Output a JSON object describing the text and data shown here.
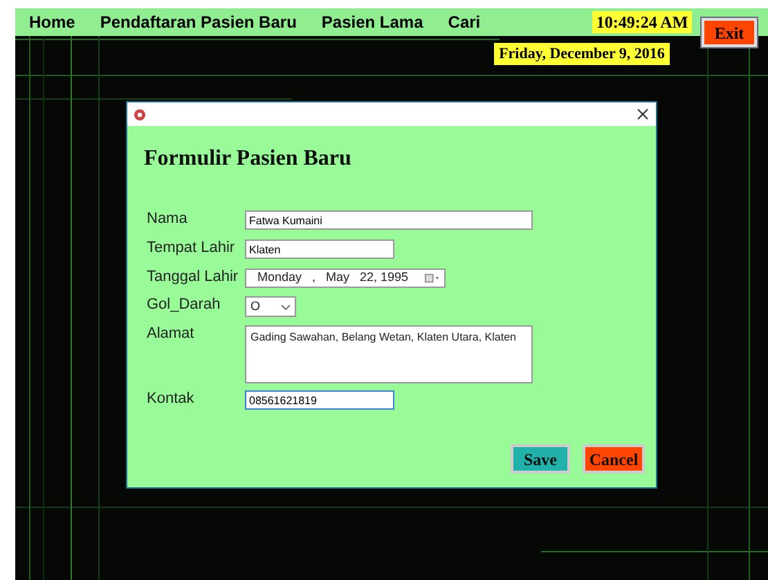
{
  "menu": [
    {
      "label": "Home"
    },
    {
      "label": "Pendaftaran Pasien Baru"
    },
    {
      "label": "Pasien Lama"
    },
    {
      "label": "Cari"
    }
  ],
  "clock": {
    "time": "10:49:24 AM",
    "date": "Friday, December 9, 2016"
  },
  "exit_button": "Exit",
  "dialog": {
    "title": "Formulir Pasien Baru",
    "fields": [
      {
        "kind": "text",
        "label": "Nama",
        "value": "Fatwa Kumaini",
        "focused": false
      },
      {
        "kind": "text",
        "label": "Tempat Lahir",
        "value": "Klaten",
        "focused": false
      },
      {
        "kind": "date",
        "label": "Tanggal Lahir",
        "parts": [
          "Monday",
          ",",
          "May",
          "22, 1995"
        ]
      },
      {
        "kind": "combo",
        "label": "Gol_Darah",
        "value": "O"
      },
      {
        "kind": "textarea",
        "label": "Alamat",
        "value": "Gading Sawahan, Belang Wetan, Klaten Utara, Klaten"
      },
      {
        "kind": "text",
        "label": "Kontak",
        "value": "08561621819",
        "focused": true
      }
    ],
    "buttons": [
      {
        "label": "Save",
        "kind": "save"
      },
      {
        "label": "Cancel",
        "kind": "cancel"
      }
    ]
  }
}
